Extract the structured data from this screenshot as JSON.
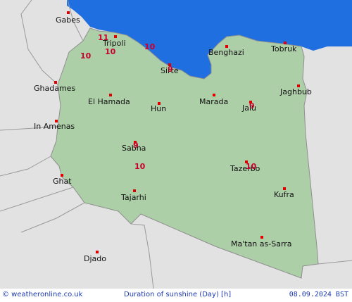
{
  "colors": {
    "sea": "#1f6fe0",
    "land": "#adcfa8",
    "outside": "#e2e2e2",
    "border": "#8f8f8f",
    "marker": "#e00000",
    "value": "#c8002e",
    "footer_text": "#1d39b3"
  },
  "cities": [
    {
      "name": "Gabes"
    },
    {
      "name": "Tripoli"
    },
    {
      "name": "Benghazi"
    },
    {
      "name": "Tobruk"
    },
    {
      "name": "Sirte"
    },
    {
      "name": "Jaghbub"
    },
    {
      "name": "Ghadames"
    },
    {
      "name": "El Hamada"
    },
    {
      "name": "Hun"
    },
    {
      "name": "Marada"
    },
    {
      "name": "Jalu"
    },
    {
      "name": "In Amenas"
    },
    {
      "name": "Sabha"
    },
    {
      "name": "Tazerbo"
    },
    {
      "name": "Ghat"
    },
    {
      "name": "Tajarhi"
    },
    {
      "name": "Kufra"
    },
    {
      "name": "Djado"
    },
    {
      "name": "Ma'tan as-Sarra"
    }
  ],
  "values": [
    "11",
    "10",
    "10",
    "10",
    "9",
    "9",
    "9",
    "10",
    "10"
  ],
  "footer": {
    "credit_icon": "copyright-icon",
    "credit": "© weatheronline.co.uk",
    "title": "Duration of sunshine (Day) [h]",
    "date": "08.09.2024 BST"
  }
}
